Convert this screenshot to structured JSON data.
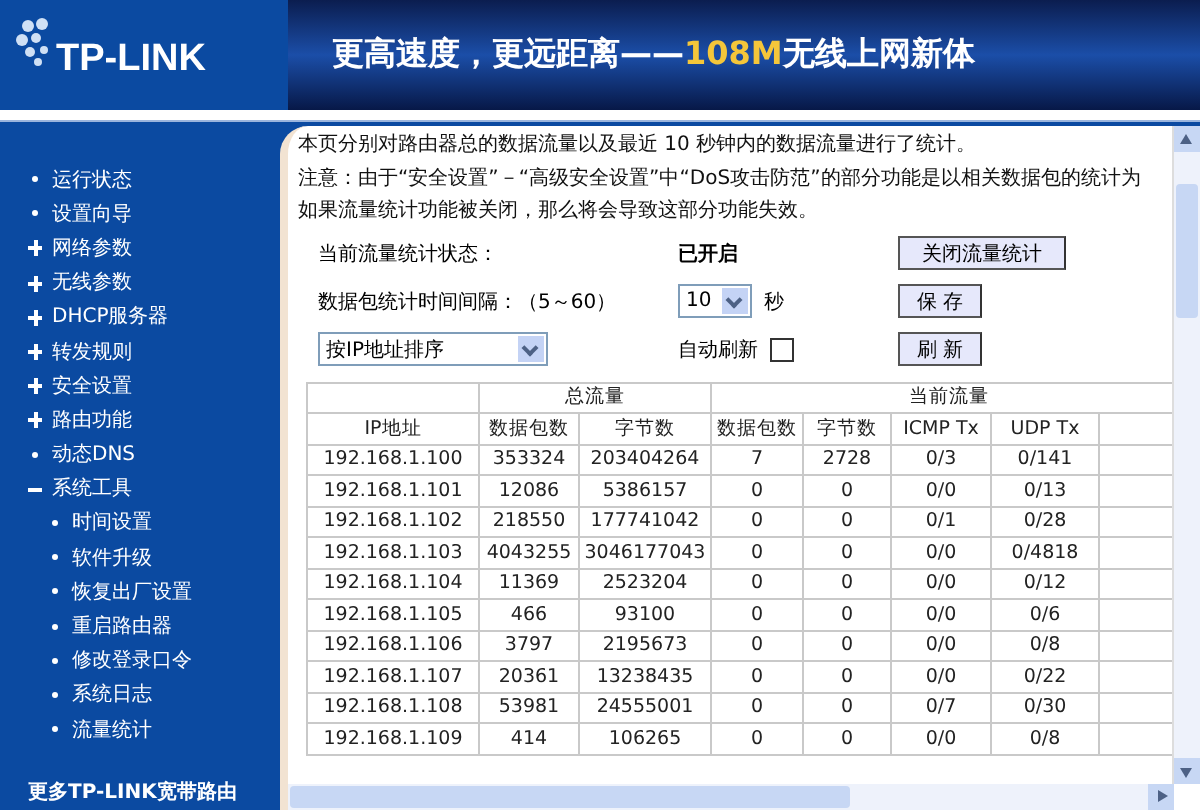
{
  "header": {
    "logo": "TP-LINK",
    "slogan": "更高速度，更远距离——",
    "highlight": "108M",
    "tail": "无线上网新体"
  },
  "sidebar": {
    "items": [
      {
        "label": "运行状态",
        "kind": "link"
      },
      {
        "label": "设置向导",
        "kind": "link"
      },
      {
        "label": "网络参数",
        "kind": "folder",
        "expanded": false
      },
      {
        "label": "无线参数",
        "kind": "folder",
        "expanded": false
      },
      {
        "label": "DHCP服务器",
        "kind": "folder",
        "expanded": false
      },
      {
        "label": "转发规则",
        "kind": "folder",
        "expanded": false
      },
      {
        "label": "安全设置",
        "kind": "folder",
        "expanded": false
      },
      {
        "label": "路由功能",
        "kind": "folder",
        "expanded": false
      },
      {
        "label": "动态DNS",
        "kind": "link"
      },
      {
        "label": "系统工具",
        "kind": "folder",
        "expanded": true,
        "children": [
          {
            "label": "时间设置",
            "kind": "link"
          },
          {
            "label": "软件升级",
            "kind": "link"
          },
          {
            "label": "恢复出厂设置",
            "kind": "link"
          },
          {
            "label": "重启路由器",
            "kind": "link"
          },
          {
            "label": "修改登录口令",
            "kind": "link"
          },
          {
            "label": "系统日志",
            "kind": "link"
          },
          {
            "label": "流量统计",
            "kind": "link"
          }
        ]
      }
    ],
    "footer": "更多TP-LINK宽带路由"
  },
  "intro": [
    "本页分别对路由器总的数据流量以及最近 10 秒钟内的数据流量进行了统计。",
    "注意：由于“安全设置”－“高级安全设置”中“DoS攻击防范”的部分功能是以相关数据包的统计为",
    "如果流量统计功能被关闭，那么将会导致这部分功能失效。"
  ],
  "status": {
    "label": "当前流量统计状态：",
    "value": "已开启",
    "button": "关闭流量统计"
  },
  "interval": {
    "label": "数据包统计时间间隔：（5～60）",
    "value": "10",
    "unit": "秒",
    "button": "保 存"
  },
  "sort": {
    "value": "按IP地址排序",
    "auto_refresh_label": "自动刷新",
    "auto_refresh": false,
    "button": "刷 新"
  },
  "table": {
    "groups": [
      "总流量",
      "当前流量"
    ],
    "columns": [
      "IP地址",
      "数据包数",
      "字节数",
      "数据包数",
      "字节数",
      "ICMP Tx",
      "UDP Tx"
    ],
    "rows": [
      [
        "192.168.1.100",
        "353324",
        "203404264",
        "7",
        "2728",
        "0/3",
        "0/141"
      ],
      [
        "192.168.1.101",
        "12086",
        "5386157",
        "0",
        "0",
        "0/0",
        "0/13"
      ],
      [
        "192.168.1.102",
        "218550",
        "177741042",
        "0",
        "0",
        "0/1",
        "0/28"
      ],
      [
        "192.168.1.103",
        "4043255",
        "3046177043",
        "0",
        "0",
        "0/0",
        "0/4818"
      ],
      [
        "192.168.1.104",
        "11369",
        "2523204",
        "0",
        "0",
        "0/0",
        "0/12"
      ],
      [
        "192.168.1.105",
        "466",
        "93100",
        "0",
        "0",
        "0/0",
        "0/6"
      ],
      [
        "192.168.1.106",
        "3797",
        "2195673",
        "0",
        "0",
        "0/0",
        "0/8"
      ],
      [
        "192.168.1.107",
        "20361",
        "13238435",
        "0",
        "0",
        "0/0",
        "0/22"
      ],
      [
        "192.168.1.108",
        "53981",
        "24555001",
        "0",
        "0",
        "0/7",
        "0/30"
      ],
      [
        "192.168.1.109",
        "414",
        "106265",
        "0",
        "0",
        "0/0",
        "0/8"
      ]
    ]
  }
}
